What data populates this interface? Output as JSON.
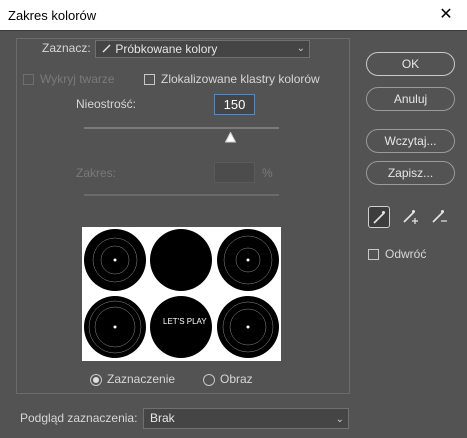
{
  "window": {
    "title": "Zakres kolorów",
    "close_glyph": "✕"
  },
  "select_row": {
    "label": "Zaznacz:",
    "value": "Próbkowane kolory",
    "icon": "eyedropper-icon"
  },
  "detect_faces": {
    "label": "Wykryj twarze",
    "checked": false,
    "enabled": false
  },
  "localized_clusters": {
    "label": "Zlokalizowane klastry kolorów",
    "checked": false
  },
  "fuzziness": {
    "label": "Nieostrość:",
    "value": "150",
    "min": 0,
    "max": 200
  },
  "range": {
    "label": "Zakres:",
    "value": "",
    "unit": "%",
    "enabled": false
  },
  "preview_mode": {
    "options": [
      "Zaznaczenie",
      "Obraz"
    ],
    "selected": "Zaznaczenie"
  },
  "preview_text": "LET'S PLAY",
  "preview_selection": {
    "label": "Podgląd zaznaczenia:",
    "value": "Brak"
  },
  "buttons": {
    "ok": "OK",
    "reset": "Anuluj",
    "load": "Wczytaj...",
    "save": "Zapisz..."
  },
  "invert": {
    "label": "Odwróć",
    "checked": false
  },
  "tools": [
    "eyedropper-icon",
    "eyedropper-plus-icon",
    "eyedropper-minus-icon"
  ],
  "colors": {
    "accent": "#3d8ee8",
    "dialog_bg": "#535353"
  }
}
